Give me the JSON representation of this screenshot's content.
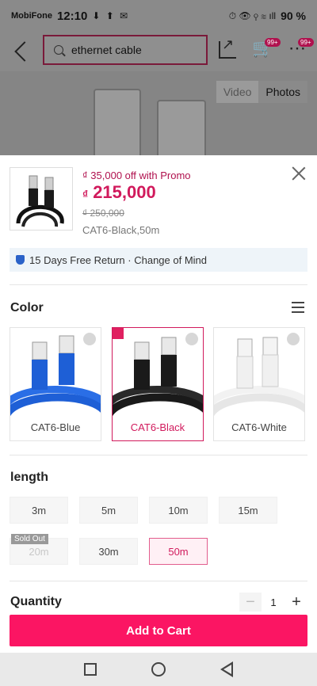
{
  "status_bar": {
    "carrier": "MobiFone",
    "time": "12:10",
    "icons": "⬇ ⬆ ✉",
    "right_icons": "⏱ 👁 ⚲ ≋ ıll",
    "battery": "90 %"
  },
  "header": {
    "search_value": "ethernet cable",
    "cart_badge": "99+",
    "more_badge": "99+"
  },
  "media_tabs": {
    "video": "Video",
    "photos": "Photos"
  },
  "product": {
    "promo": "₫ 35,000 off with Promo",
    "currency": "₫",
    "price": "215,000",
    "old_price": "₫ 250,000",
    "selected_variant": "CAT6-Black,50m"
  },
  "return_policy": "15 Days Free Return · Change of Mind",
  "color_section": {
    "title": "Color",
    "options": [
      {
        "label": "CAT6-Blue",
        "selected": false,
        "color": "#1e5fd6"
      },
      {
        "label": "CAT6-Black",
        "selected": true,
        "color": "#1a1a1a"
      },
      {
        "label": "CAT6-White",
        "selected": false,
        "color": "#f0f0f0"
      }
    ]
  },
  "length_section": {
    "title": "length",
    "options": [
      "3m",
      "5m",
      "10m",
      "15m",
      "20m",
      "30m",
      "50m"
    ],
    "sold_out_label": "Sold Out",
    "selected": "50m"
  },
  "quantity": {
    "title": "Quantity",
    "value": "1",
    "minus": "−",
    "plus": "+"
  },
  "cta": {
    "add_to_cart": "Add to Cart"
  },
  "colors": {
    "accent": "#fb1563",
    "price": "#d11a5c"
  }
}
